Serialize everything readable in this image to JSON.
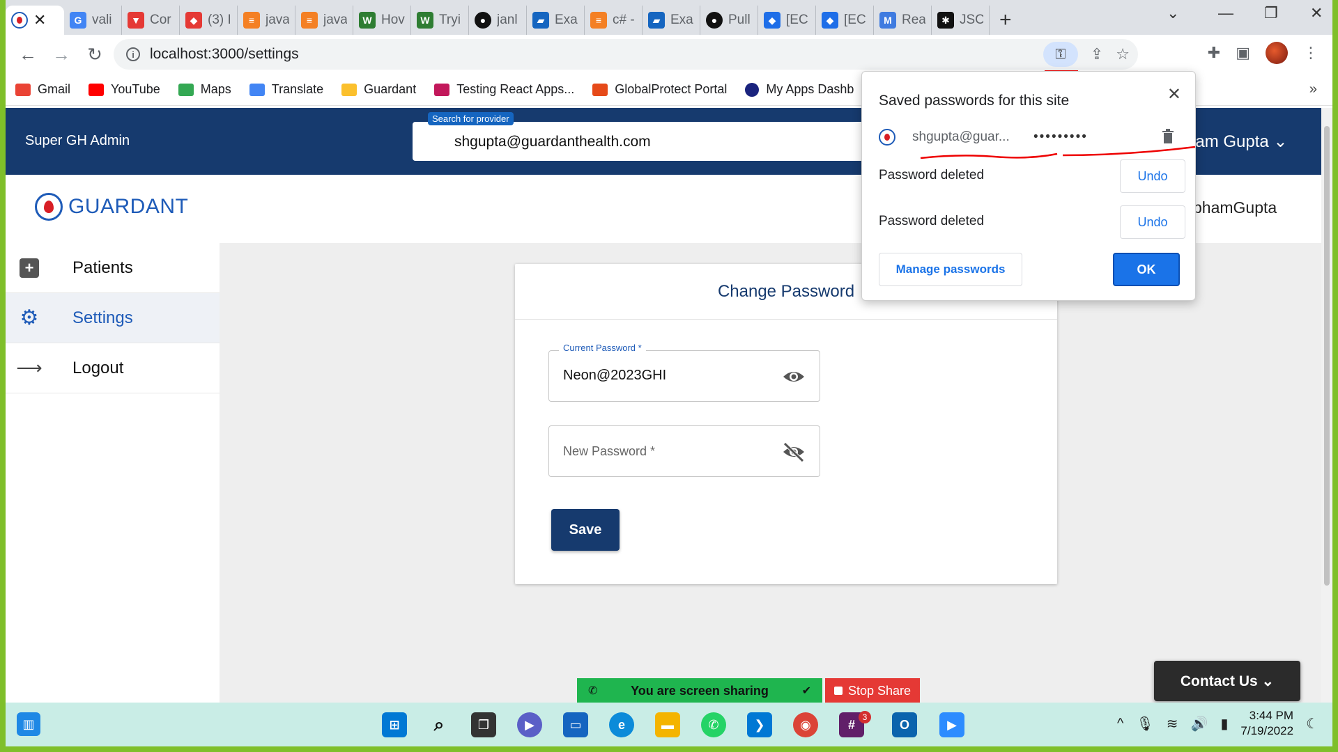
{
  "browser": {
    "tabs": [
      {
        "title": "",
        "icon_color": "#d81f26",
        "icon": "guardant-icon"
      },
      {
        "title": "vali",
        "icon_color": "#4285f4",
        "icon": "google-icon"
      },
      {
        "title": "Cor",
        "icon_color": "#e53935",
        "icon": "vercel-icon"
      },
      {
        "title": "(3) I",
        "icon_color": "#e53935",
        "icon": "shield-icon"
      },
      {
        "title": "java",
        "icon_color": "#f48024",
        "icon": "stackoverflow-icon"
      },
      {
        "title": "java",
        "icon_color": "#f48024",
        "icon": "stackoverflow-icon"
      },
      {
        "title": "Hov",
        "icon_color": "#2e7d32",
        "icon": "w3-icon"
      },
      {
        "title": "Tryi",
        "icon_color": "#2e7d32",
        "icon": "w3-icon"
      },
      {
        "title": "janl",
        "icon_color": "#111111",
        "icon": "github-icon"
      },
      {
        "title": "Exa",
        "icon_color": "#1565c0",
        "icon": "docs-icon"
      },
      {
        "title": "c# -",
        "icon_color": "#f48024",
        "icon": "stackoverflow-icon"
      },
      {
        "title": "Exa",
        "icon_color": "#1565c0",
        "icon": "docs-icon"
      },
      {
        "title": "Pull",
        "icon_color": "#111111",
        "icon": "github-icon"
      },
      {
        "title": "[EC",
        "icon_color": "#1e6ee8",
        "icon": "jira-icon"
      },
      {
        "title": "[EC",
        "icon_color": "#1e6ee8",
        "icon": "jira-icon"
      },
      {
        "title": "Rea",
        "icon_color": "#3f7be0",
        "icon": "mui-icon"
      },
      {
        "title": "JSC",
        "icon_color": "#111111",
        "icon": "jscolor-icon"
      }
    ],
    "url": "localhost:3000/settings",
    "bookmarks": [
      {
        "label": "Gmail",
        "color": "#ea4335"
      },
      {
        "label": "YouTube",
        "color": "#ff0000"
      },
      {
        "label": "Maps",
        "color": "#34a853"
      },
      {
        "label": "Translate",
        "color": "#4285f4"
      },
      {
        "label": "Guardant",
        "color": "#fbc02d"
      },
      {
        "label": "Testing React Apps...",
        "color": "#c2185b"
      },
      {
        "label": "GlobalProtect Portal",
        "color": "#e64a19"
      },
      {
        "label": "My Apps Dashb",
        "color": "#1a237e"
      }
    ],
    "bookmarks_more": "»"
  },
  "app": {
    "title": "Super GH Admin",
    "search_label": "Search for provider",
    "search_value": "shgupta@guardanthealth.com",
    "user_name": "ham Gupta",
    "user_short": "bhamGupta",
    "logo_text": "GUARDANT",
    "colors": {
      "primary": "#163a6e",
      "accent": "#1e5bb8",
      "brand_red": "#d81f26"
    }
  },
  "sidebar": {
    "items": [
      {
        "label": "Patients",
        "icon": "plus-box-icon"
      },
      {
        "label": "Settings",
        "icon": "gear-icon"
      },
      {
        "label": "Logout",
        "icon": "arrow-right-icon"
      }
    ]
  },
  "form": {
    "title": "Change Password",
    "current_label": "Current Password *",
    "current_value": "Neon@2023GHI",
    "new_placeholder": "New Password *",
    "save_label": "Save"
  },
  "password_popup": {
    "title": "Saved passwords for this site",
    "username": "shgupta@guar...",
    "password_mask": "•••••••••",
    "deleted_1": "Password deleted",
    "deleted_2": "Password deleted",
    "undo_label": "Undo",
    "manage_label": "Manage passwords",
    "ok_label": "OK"
  },
  "screen_share": {
    "status": "You are screen sharing",
    "stop_label": "Stop Share"
  },
  "contact": {
    "label": "Contact Us"
  },
  "taskbar": {
    "time": "3:44 PM",
    "date": "7/19/2022",
    "slack_badge": "3"
  }
}
